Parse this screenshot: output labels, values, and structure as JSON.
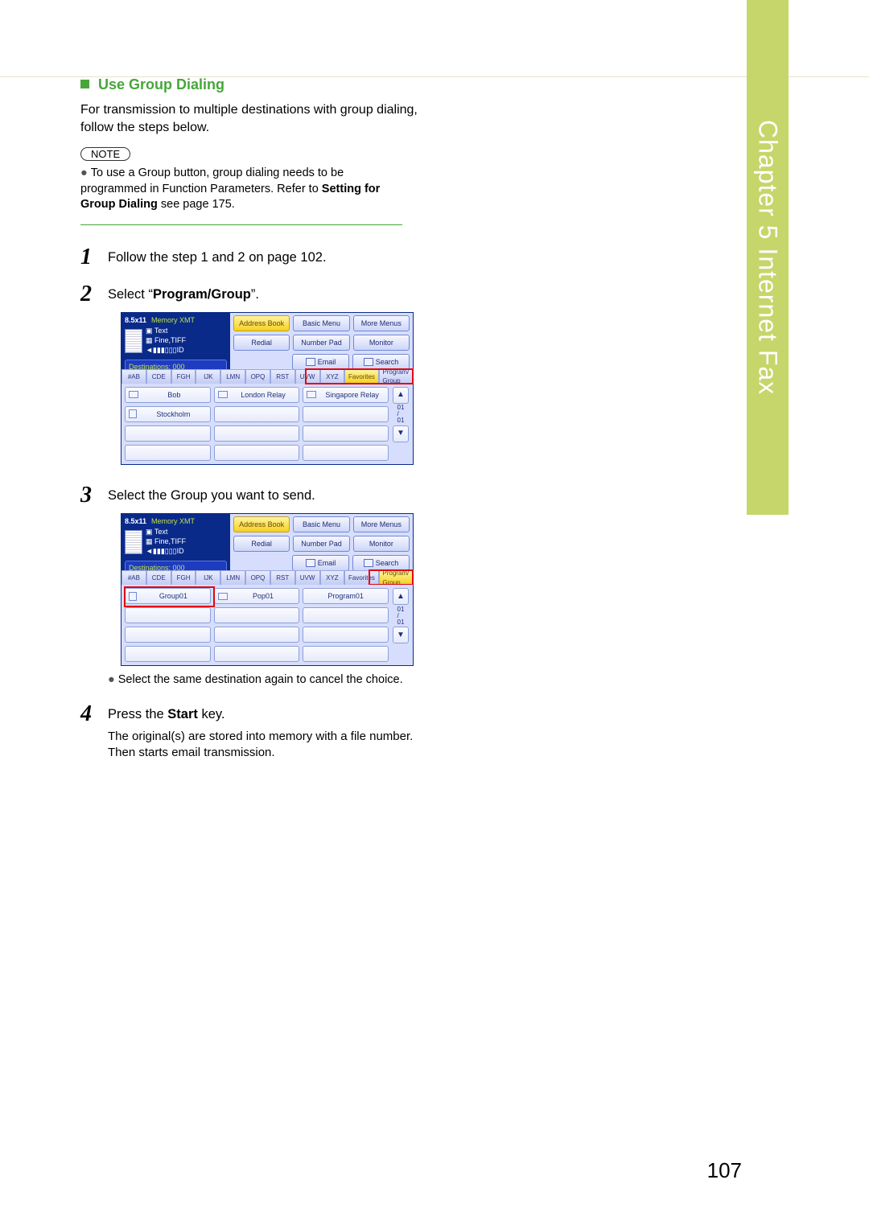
{
  "sideTab": "Chapter 5    Internet Fax",
  "section": {
    "title": "Use Group Dialing",
    "intro": "For transmission to multiple destinations with group dialing, follow the steps below."
  },
  "note": {
    "label": "NOTE",
    "body_pre": "To use a Group button, group dialing needs to be programmed in Function Parameters. Refer to ",
    "body_bold": "Setting for Group Dialing",
    "body_post": " see page 175."
  },
  "steps": {
    "s1": {
      "num": "1",
      "text": "Follow the step 1 and 2 on page 102."
    },
    "s2": {
      "num": "2",
      "pre": "Select “",
      "bold": "Program/Group",
      "post": "”."
    },
    "s3": {
      "num": "3",
      "text": "Select the Group you want to send.",
      "sub": "Select the same destination again to cancel the choice."
    },
    "s4": {
      "num": "4",
      "pre": "Press the ",
      "bold": "Start",
      "post": " key.",
      "sub": "The original(s) are stored into memory with a file number. Then starts email transmission."
    }
  },
  "fax": {
    "size": "8.5x11",
    "memxmt": "Memory XMT",
    "mode1": "Text",
    "mode2": "Fine,TIFF",
    "id": "ID",
    "dest": "Destinations: 000",
    "topbtns": {
      "addressBook": "Address Book",
      "basicMenu": "Basic Menu",
      "moreMenus": "More Menus",
      "redial": "Redial",
      "numberPad": "Number Pad",
      "monitor": "Monitor",
      "email": "Email",
      "search": "Search"
    },
    "tabs": [
      "#AB",
      "CDE",
      "FGH",
      "IJK",
      "LMN",
      "OPQ",
      "RST",
      "UVW",
      "XYZ"
    ],
    "favorites": "Favorites",
    "programGroup": "Program/\nGroup",
    "page": "01\n/\n01",
    "listA": {
      "r0c0": "Bob",
      "r0c1": "London Relay",
      "r0c2": "Singapore Relay",
      "r1c0": "Stockholm"
    },
    "listB": {
      "r0c0": "Group01",
      "r0c1": "Pop01",
      "r0c2": "Program01"
    }
  },
  "pageNumber": "107"
}
